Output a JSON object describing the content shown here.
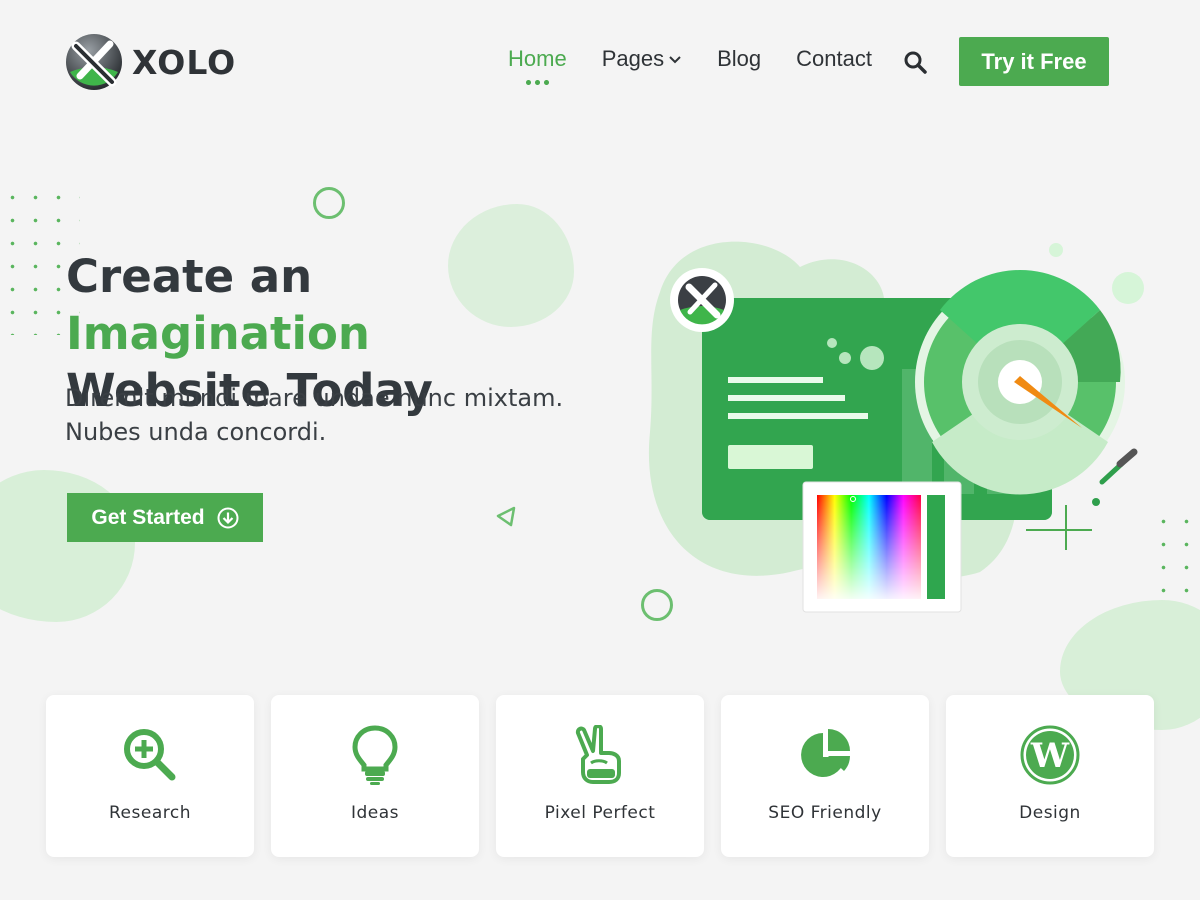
{
  "brand": {
    "name": "XOLO",
    "primary_color": "#4caa50",
    "light_green": "#d8efd8"
  },
  "nav": {
    "items": [
      {
        "label": "Home",
        "active": true
      },
      {
        "label": "Pages",
        "has_dropdown": true
      },
      {
        "label": "Blog"
      },
      {
        "label": "Contact"
      }
    ],
    "search_icon": "search-icon",
    "cta_label": "Try it Free"
  },
  "hero": {
    "title_part1": "Create an",
    "title_accent": "Imagination",
    "title_part2": "Website Today",
    "subtitle_line1": "Diremit mundi mare undae nunc mixtam.",
    "subtitle_line2": "Nubes unda concordi.",
    "cta_label": "Get Started",
    "cta_icon": "arrow-circle-down-icon"
  },
  "features": [
    {
      "label": "Research",
      "icon": "magnifier-plus-icon"
    },
    {
      "label": "Ideas",
      "icon": "lightbulb-icon"
    },
    {
      "label": "Pixel Perfect",
      "icon": "victory-hand-icon"
    },
    {
      "label": "SEO Friendly",
      "icon": "pie-chart-icon"
    },
    {
      "label": "Design",
      "icon": "wordpress-icon"
    }
  ]
}
